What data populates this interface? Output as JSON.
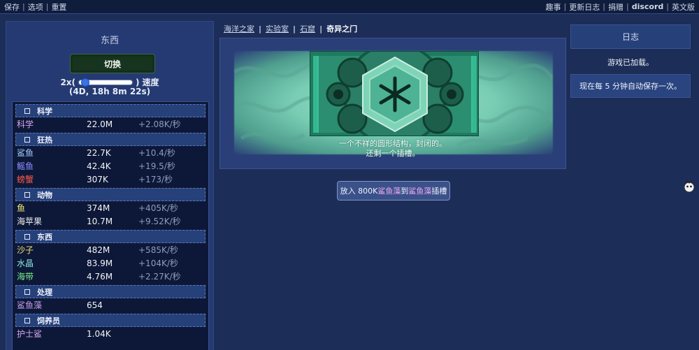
{
  "topbar": {
    "left": [
      "保存",
      "选项",
      "重置"
    ],
    "right": [
      "趣事",
      "更新日志",
      "捐赠",
      "discord",
      "英文版"
    ]
  },
  "left_panel": {
    "title": "东西",
    "switch_button": "切换",
    "speed_prefix": "2x(",
    "speed_suffix": ")",
    "speed_label": "速度",
    "speed_slider_fraction": 0.05,
    "time": "(4D, 18h 8m 22s)"
  },
  "resources": [
    {
      "category": "科学",
      "items": [
        {
          "name": "科学",
          "amount": "22.0M",
          "rate": "+2.08K/秒",
          "color": "#d6a4ec"
        }
      ]
    },
    {
      "category": "狂热",
      "items": [
        {
          "name": "鲨鱼",
          "amount": "22.7K",
          "rate": "+10.4/秒",
          "color": "#9fc9ff"
        },
        {
          "name": "鳐鱼",
          "amount": "42.4K",
          "rate": "+19.5/秒",
          "color": "#8a8cff"
        },
        {
          "name": "螃蟹",
          "amount": "307K",
          "rate": "+173/秒",
          "color": "#ff5a4a"
        }
      ]
    },
    {
      "category": "动物",
      "items": [
        {
          "name": "鱼",
          "amount": "374M",
          "rate": "+405K/秒",
          "color": "#f3ea7a"
        },
        {
          "name": "海苹果",
          "amount": "10.7M",
          "rate": "+9.52K/秒",
          "color": "#f1f1f1"
        }
      ]
    },
    {
      "category": "东西",
      "items": [
        {
          "name": "沙子",
          "amount": "482M",
          "rate": "+585K/秒",
          "color": "#f1e079"
        },
        {
          "name": "水晶",
          "amount": "83.9M",
          "rate": "+104K/秒",
          "color": "#8fe6e0"
        },
        {
          "name": "海带",
          "amount": "4.76M",
          "rate": "+2.27K/秒",
          "color": "#7df08a"
        }
      ]
    },
    {
      "category": "处理",
      "items": [
        {
          "name": "鲨鱼藻",
          "amount": "654",
          "rate": "",
          "color": "#c59be6"
        }
      ]
    },
    {
      "category": "饲养员",
      "items": [
        {
          "name": "护士鲨",
          "amount": "1.04K",
          "rate": "",
          "color": "#d6a4ec"
        }
      ]
    }
  ],
  "breadcrumb": {
    "links": [
      "海洋之家",
      "实验室",
      "石窟"
    ],
    "current": "奇异之门"
  },
  "gate": {
    "caption_line1": "一个不祥的圆形结构，封闭的。",
    "caption_line2": "还剩一个插槽。"
  },
  "place_button": {
    "prefix": "放入 800K ",
    "item1": "鲨鱼藻",
    "mid": "到 ",
    "item2": "鲨鱼藻",
    "suffix": "插槽"
  },
  "log": {
    "title": "日志",
    "entries": [
      "游戏已加载。",
      "现在每 5 分钟自动保存一次。"
    ]
  },
  "icons": [
    "checkbox-icon",
    "gate-sigil-icon",
    "user-avatar-icon"
  ]
}
